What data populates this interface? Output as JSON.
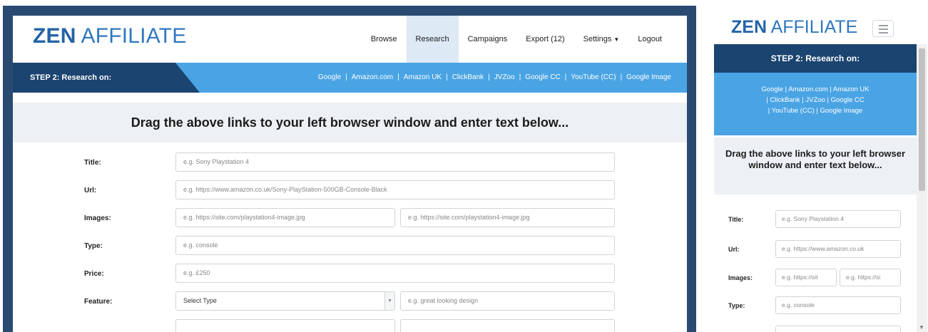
{
  "desktop": {
    "logo": {
      "bold": "ZEN",
      "rest": " AFFILIATE"
    },
    "nav": [
      {
        "label": "Browse"
      },
      {
        "label": "Research"
      },
      {
        "label": "Campaigns"
      },
      {
        "label": "Export (12)"
      },
      {
        "label": "Settings"
      },
      {
        "label": "Logout"
      }
    ],
    "step_label": "STEP 2: Research on:",
    "links": [
      "Google",
      "Amazon.com",
      "Amazon UK",
      "ClickBank",
      "JVZoo",
      "Google CC",
      "YouTube (CC)",
      "Google Image"
    ],
    "banner": "Drag the above links to your left browser window and enter text below...",
    "form": {
      "title": {
        "label": "Title:",
        "placeholder": "e.g. Sony Playstation 4"
      },
      "url": {
        "label": "Url:",
        "placeholder": "e.g. https://www.amazon.co.uk/Sony-PlayStation-500GB-Console-Black"
      },
      "images": {
        "label": "Images:",
        "placeholder1": "e.g. https://site.com/playstation4-image.jpg",
        "placeholder2": "e.g. https://site.com/playstation4-image.jpg"
      },
      "type": {
        "label": "Type:",
        "placeholder": "e.g. console"
      },
      "price": {
        "label": "Price:",
        "placeholder": "e.g. £250"
      },
      "feature": {
        "label": "Feature:",
        "select_value": "Select Type",
        "placeholder": "e.g. great looking design"
      }
    }
  },
  "mobile": {
    "logo": {
      "bold": "ZEN",
      "rest": " AFFILIATE"
    },
    "step_label": "STEP 2: Research on:",
    "links_line1": "Google | Amazon.com | Amazon UK",
    "links_line2": "| ClickBank | JVZoo | Google CC",
    "links_line3": "| YouTube (CC) | Google Image",
    "banner": "Drag the above links to your left browser window and enter text below...",
    "form": {
      "title": {
        "label": "Title:",
        "placeholder": "e.g. Sony Playstation 4"
      },
      "url": {
        "label": "Url:",
        "placeholder": "e.g. https://www.amazon.co.uk"
      },
      "images": {
        "label": "Images:",
        "placeholder1": "e.g. https://sit",
        "placeholder2": "e.g. https://si"
      },
      "type": {
        "label": "Type:",
        "placeholder": "e.g. console"
      }
    }
  },
  "colors": {
    "brand": "#2f78bf",
    "dark_blue": "#1b4470",
    "light_blue": "#4aa4e4",
    "banner_bg": "#edf1f5"
  },
  "icons": {
    "menu": "hamburger-icon",
    "dropdown": "chevron-down-icon"
  }
}
